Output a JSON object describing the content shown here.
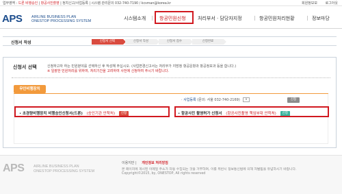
{
  "topbar": {
    "notice_prefix": "업무영역",
    "notice_hl1": "드론 비행승인",
    "notice_hl2": "항공사진촬영",
    "notice_rest": "정치신고/사업등록 | 시스템 관리문의 032-740-7190 / kcsman@korea.kr",
    "util_login": "회원정보보",
    "util_logout": "로그아웃"
  },
  "logo": {
    "mark": "APS",
    "line1": "AIRLINE BUSINESS PLAN",
    "line2": "ONESTOP PROCESSING SYSTEM"
  },
  "nav": {
    "items": [
      "시스템소개",
      "항공민원신청",
      "처리부서 · 담당자지정",
      "항공민원처리현황",
      "정보마당"
    ],
    "active_index": 1
  },
  "page": {
    "title": "신청서 작성"
  },
  "steps": [
    "신청서 선택",
    "신청서 작성",
    "신청서 접수",
    "신청완료"
  ],
  "selection": {
    "title": "신청서 선택",
    "desc": "신청하고자 하는 민원분야를 선택하신 후 작성해 주십시오. (사업변경신고서는 처리부가 지방청 항공운항과 항공정보과 등을 합니다.)",
    "warn": "※ 일괄한 민원처리를 위하여, 처리기간을 고려하여 사전에 신청하여 주시기 바랍니다."
  },
  "category": {
    "label": "무인비행장치"
  },
  "consult": {
    "label": "사업등록",
    "text": "(문의: 서울 032-740-2169)",
    "select_value": "∨",
    "button": "신청"
  },
  "rows": [
    {
      "name": "초경량비행장치 비행승인신청서(드론)",
      "note": "(승인기관 안착처)",
      "button": "신청",
      "button_color": "#d94b3f"
    },
    {
      "name": "항공사진 촬영허가 신청서",
      "note": "(항공사진촬영 책임부대 안착처)",
      "button": "신청",
      "button_color": "#3bb39d"
    }
  ],
  "footer": {
    "logo_mark": "APS",
    "logo_line1": "AIRLINE BUSINESS PLAN",
    "logo_line2": "ONESTOP PROCESSING SYSTEM",
    "link_terms": "이용지만",
    "link_privacy": "개인정보 처리방침",
    "line1": "본 페이지에 게시된 이메일 주소가 자동 수집되는 것을 거부하며, 이를 위반시 정보통신법에 의해 처벌됨을 유념하시기 바랍니다.",
    "line2": "Copyright©2015, by, ONESTOP, All rights reserved"
  },
  "colors": {
    "brand_blue": "#1b4c8c",
    "highlight_red": "#d1181f",
    "category_orange": "#f29a3c"
  }
}
